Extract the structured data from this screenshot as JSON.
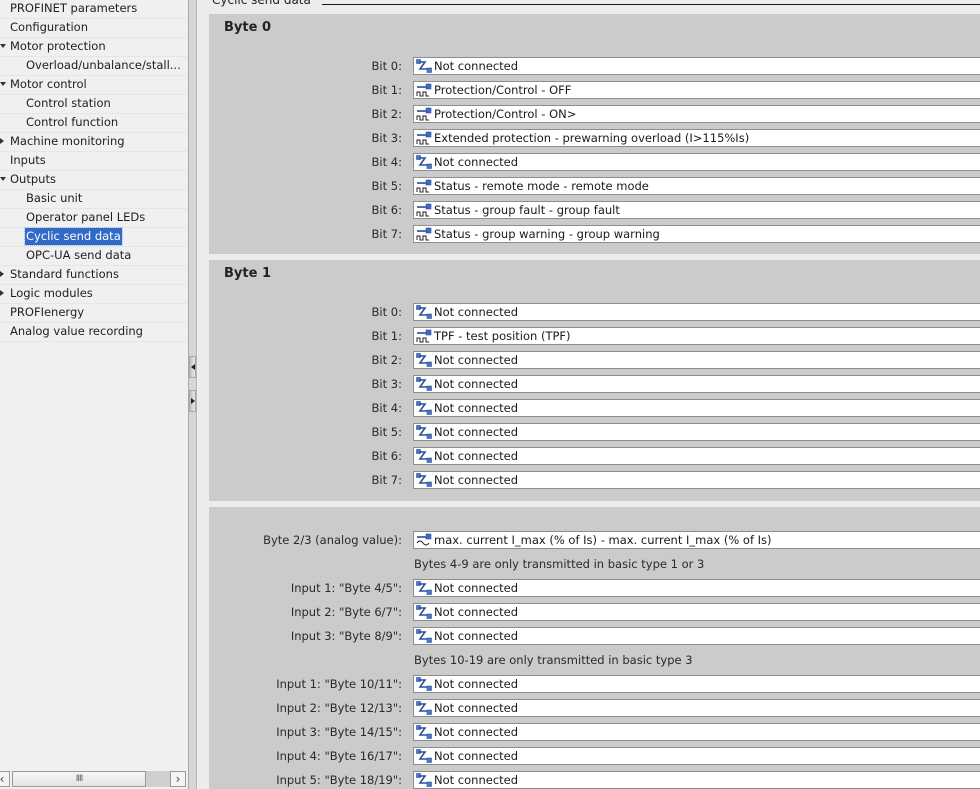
{
  "tree": {
    "items": [
      {
        "label": "PROFINET parameters",
        "level": 0,
        "expander": "none"
      },
      {
        "label": "Configuration",
        "level": 0,
        "expander": "none"
      },
      {
        "label": "Motor protection",
        "level": 0,
        "expander": "expanded"
      },
      {
        "label": "Overload/unbalance/stall...",
        "level": 1,
        "expander": "none"
      },
      {
        "label": "Motor control",
        "level": 0,
        "expander": "expanded"
      },
      {
        "label": "Control station",
        "level": 1,
        "expander": "none"
      },
      {
        "label": "Control function",
        "level": 1,
        "expander": "none"
      },
      {
        "label": "Machine monitoring",
        "level": 0,
        "expander": "collapsed"
      },
      {
        "label": "Inputs",
        "level": 0,
        "expander": "none"
      },
      {
        "label": "Outputs",
        "level": 0,
        "expander": "expanded"
      },
      {
        "label": "Basic unit",
        "level": 1,
        "expander": "none"
      },
      {
        "label": "Operator panel LEDs",
        "level": 1,
        "expander": "none"
      },
      {
        "label": "Cyclic send data",
        "level": 1,
        "expander": "none",
        "selected": true
      },
      {
        "label": "OPC-UA send data",
        "level": 1,
        "expander": "none"
      },
      {
        "label": "Standard functions",
        "level": 0,
        "expander": "collapsed"
      },
      {
        "label": "Logic modules",
        "level": 0,
        "expander": "collapsed"
      },
      {
        "label": "PROFIenergy",
        "level": 0,
        "expander": "none"
      },
      {
        "label": "Analog value recording",
        "level": 0,
        "expander": "none"
      }
    ],
    "scrollbar": {
      "left": "‹",
      "right": "›",
      "thumb": "IIII"
    }
  },
  "main": {
    "section_title": "Cyclic send data",
    "byte0": {
      "title": "Byte 0",
      "rows": [
        {
          "label": "Bit 0:",
          "value": "Not connected",
          "icon": "not-connected-icon"
        },
        {
          "label": "Bit 1:",
          "value": "Protection/Control - OFF",
          "icon": "binary-signal-icon"
        },
        {
          "label": "Bit 2:",
          "value": "Protection/Control - ON>",
          "icon": "binary-signal-icon"
        },
        {
          "label": "Bit 3:",
          "value": "Extended protection - prewarning overload (I>115%Is)",
          "icon": "binary-signal-icon"
        },
        {
          "label": "Bit 4:",
          "value": "Not connected",
          "icon": "not-connected-icon"
        },
        {
          "label": "Bit 5:",
          "value": "Status - remote mode - remote mode",
          "icon": "binary-signal-icon"
        },
        {
          "label": "Bit 6:",
          "value": "Status - group fault - group fault",
          "icon": "binary-signal-icon"
        },
        {
          "label": "Bit 7:",
          "value": "Status - group warning - group warning",
          "icon": "binary-signal-icon"
        }
      ]
    },
    "byte1": {
      "title": "Byte 1",
      "rows": [
        {
          "label": "Bit 0:",
          "value": "Not connected",
          "icon": "not-connected-icon"
        },
        {
          "label": "Bit 1:",
          "value": "TPF - test position (TPF)",
          "icon": "binary-signal-icon"
        },
        {
          "label": "Bit 2:",
          "value": "Not connected",
          "icon": "not-connected-icon"
        },
        {
          "label": "Bit 3:",
          "value": "Not connected",
          "icon": "not-connected-icon"
        },
        {
          "label": "Bit 4:",
          "value": "Not connected",
          "icon": "not-connected-icon"
        },
        {
          "label": "Bit 5:",
          "value": "Not connected",
          "icon": "not-connected-icon"
        },
        {
          "label": "Bit 6:",
          "value": "Not connected",
          "icon": "not-connected-icon"
        },
        {
          "label": "Bit 7:",
          "value": "Not connected",
          "icon": "not-connected-icon"
        }
      ]
    },
    "analog": {
      "byte23": {
        "label": "Byte 2/3 (analog value):",
        "value": "max. current I_max (% of Is) - max. current I_max (% of Is)",
        "icon": "analog-signal-icon"
      },
      "note1": "Bytes 4-9 are only transmitted in basic type 1 or 3",
      "rows1": [
        {
          "label": "Input 1: \"Byte 4/5\":",
          "value": "Not connected",
          "icon": "not-connected-icon"
        },
        {
          "label": "Input 2: \"Byte 6/7\":",
          "value": "Not connected",
          "icon": "not-connected-icon"
        },
        {
          "label": "Input 3: \"Byte 8/9\":",
          "value": "Not connected",
          "icon": "not-connected-icon"
        }
      ],
      "note2": "Bytes 10-19 are only transmitted in basic type 3",
      "rows2": [
        {
          "label": "Input 1: \"Byte 10/11\":",
          "value": "Not connected",
          "icon": "not-connected-icon"
        },
        {
          "label": "Input 2: \"Byte 12/13\":",
          "value": "Not connected",
          "icon": "not-connected-icon"
        },
        {
          "label": "Input 3: \"Byte 14/15\":",
          "value": "Not connected",
          "icon": "not-connected-icon"
        },
        {
          "label": "Input 4: \"Byte 16/17\":",
          "value": "Not connected",
          "icon": "not-connected-icon"
        },
        {
          "label": "Input 5: \"Byte 18/19\":",
          "value": "Not connected",
          "icon": "not-connected-icon"
        }
      ]
    }
  }
}
